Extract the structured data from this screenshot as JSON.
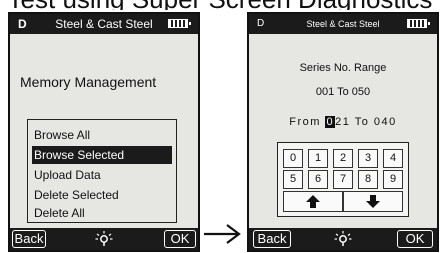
{
  "caption": "Test using Super Screen Diagnostics",
  "screen_left": {
    "mode": "D",
    "title": "Steel & Cast Steel",
    "heading": "Memory Management",
    "menu": [
      {
        "label": "Browse All"
      },
      {
        "label": "Browse Selected",
        "selected": true
      },
      {
        "label": "Upload Data"
      },
      {
        "label": "Delete Selected"
      },
      {
        "label": "Delete All"
      }
    ],
    "back_label": "Back",
    "ok_label": "OK"
  },
  "screen_right": {
    "mode": "D",
    "title": "Steel & Cast Steel",
    "heading": "Series No. Range",
    "range": "001 To 050",
    "from_label": "From",
    "from_cursor": "0",
    "from_rest": "21",
    "to_label": "To",
    "to_value": "040",
    "keys": [
      "0",
      "1",
      "2",
      "3",
      "4",
      "5",
      "6",
      "7",
      "8",
      "9"
    ],
    "back_label": "Back",
    "ok_label": "OK"
  },
  "icons": [
    "battery-icon",
    "lamp-icon",
    "up-arrow-icon",
    "down-arrow-icon",
    "flow-arrow-icon"
  ]
}
